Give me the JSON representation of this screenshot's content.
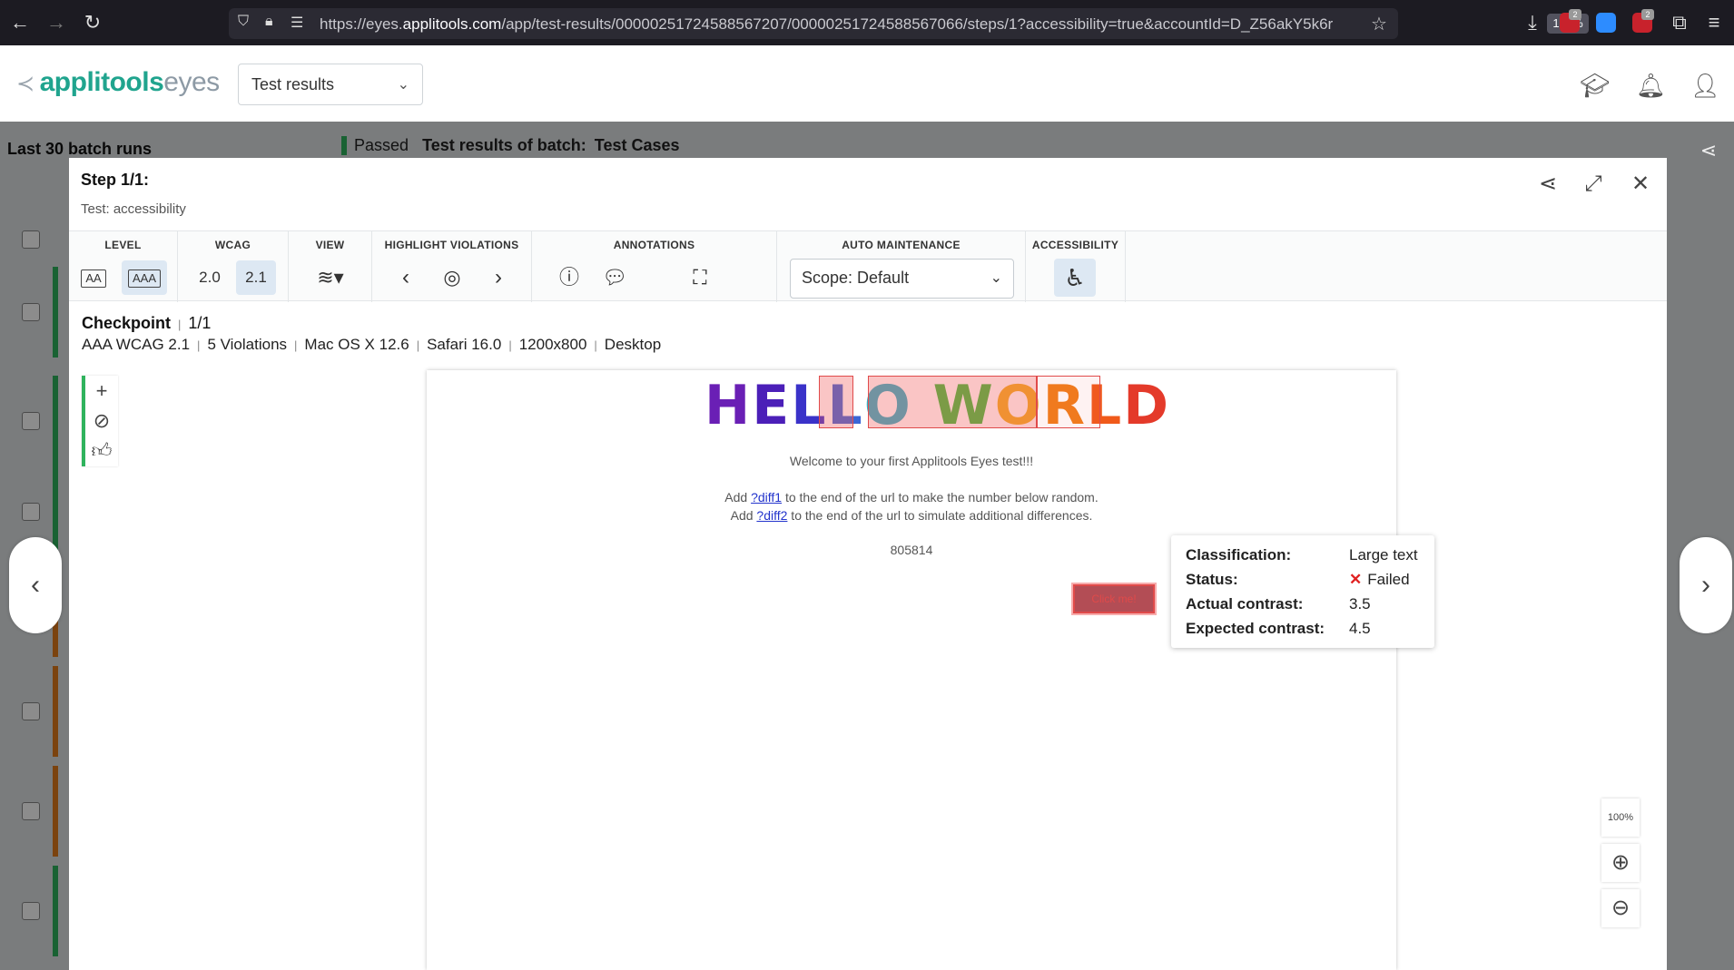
{
  "browser": {
    "url_prefix": "https://eyes.",
    "url_host": "applitools.com",
    "url_rest": "/app/test-results/00000251724588567207/00000251724588567066/steps/1?accessibility=true&accountId=D_Z56akY5k6r",
    "zoom": "120%",
    "ext_badges": [
      "2",
      "2"
    ]
  },
  "header": {
    "logo_main": "applitools",
    "logo_sub": "eyes",
    "results_select": "Test results"
  },
  "background": {
    "title": "Last 30 batch runs",
    "status": "Passed",
    "batch_label": "Test results of batch:",
    "batch_name": "Test Cases"
  },
  "step": {
    "title": "Step 1/1:",
    "subtitle": "Test: accessibility"
  },
  "toolbar": {
    "level_label": "LEVEL",
    "level_options": [
      "AA",
      "AAA"
    ],
    "wcag_label": "WCAG",
    "wcag_options": [
      "2.0",
      "2.1"
    ],
    "view_label": "VIEW",
    "highlight_label": "HIGHLIGHT VIOLATIONS",
    "annotations_label": "ANNOTATIONS",
    "auto_label": "AUTO MAINTENANCE",
    "scope": "Scope: Default",
    "accessibility_label": "ACCESSIBILITY"
  },
  "checkpoint": {
    "label": "Checkpoint",
    "count": "1/1",
    "standard": "AAA WCAG 2.1",
    "violations": "5 Violations",
    "os": "Mac OS X 12.6",
    "browser": "Safari 16.0",
    "viewport": "1200x800",
    "device": "Desktop"
  },
  "capture": {
    "hello_letters": [
      "H",
      "E",
      "L",
      "L",
      "O",
      " ",
      "W",
      "O",
      "R",
      "L",
      "D"
    ],
    "hello_colors": [
      "#6a1fb5",
      "#4b1fb8",
      "#3a32c9",
      "#3b66d6",
      "#2fb3c8",
      "",
      "#3cbf3c",
      "#f0b020",
      "#f07d1a",
      "#f05a1a",
      "#e43a2a"
    ],
    "welcome": "Welcome to your first Applitools Eyes test!!!",
    "line1_pre": "Add ",
    "line1_link": "?diff1",
    "line1_post": " to the end of the url to make the number below random.",
    "line2_pre": "Add ",
    "line2_link": "?diff2",
    "line2_post": " to the end of the url to simulate additional differences.",
    "number": "805814",
    "button": "Click me!"
  },
  "tooltip": {
    "classification_k": "Classification:",
    "classification_v": "Large text",
    "status_k": "Status:",
    "status_v": "Failed",
    "actual_k": "Actual contrast:",
    "actual_v": "3.5",
    "expected_k": "Expected contrast:",
    "expected_v": "4.5"
  },
  "zoom_controls": {
    "fit_label": "100%"
  }
}
